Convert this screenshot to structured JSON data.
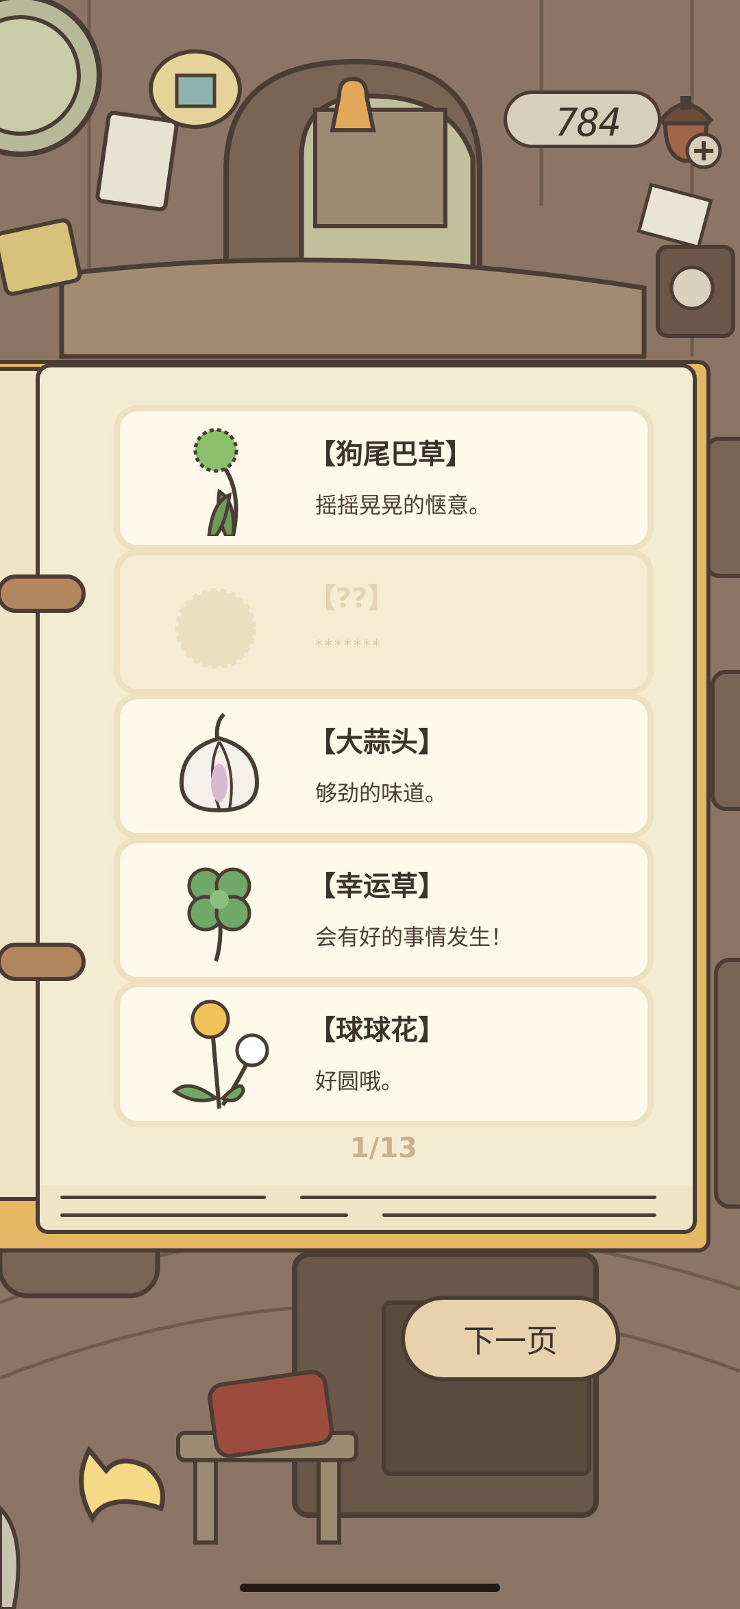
{
  "currency": {
    "value": "784",
    "icon": "acorn-icon",
    "add_icon": "plus-icon"
  },
  "collection": {
    "items": [
      {
        "name": "【狗尾巴草】",
        "desc": "摇摇晃晃的惬意。",
        "icon": "foxtail-grass-icon",
        "locked": false
      },
      {
        "name": "【??】",
        "desc": "*******",
        "icon": "locked-silhouette-icon",
        "locked": true
      },
      {
        "name": "【大蒜头】",
        "desc": "够劲的味道。",
        "icon": "garlic-icon",
        "locked": false
      },
      {
        "name": "【幸运草】",
        "desc": "会有好的事情发生！",
        "icon": "clover-icon",
        "locked": false
      },
      {
        "name": "【球球花】",
        "desc": "好圆哦。",
        "icon": "ball-flower-icon",
        "locked": false
      }
    ],
    "page_indicator": "1/13"
  },
  "nav": {
    "next_label": "下一页",
    "back_icon": "back-arrow-icon"
  },
  "colors": {
    "outline": "#4b3d33",
    "page": "#f4ebd3",
    "card": "#fff9ea",
    "book_edge": "#e6b765",
    "button": "#e8d2ae"
  }
}
